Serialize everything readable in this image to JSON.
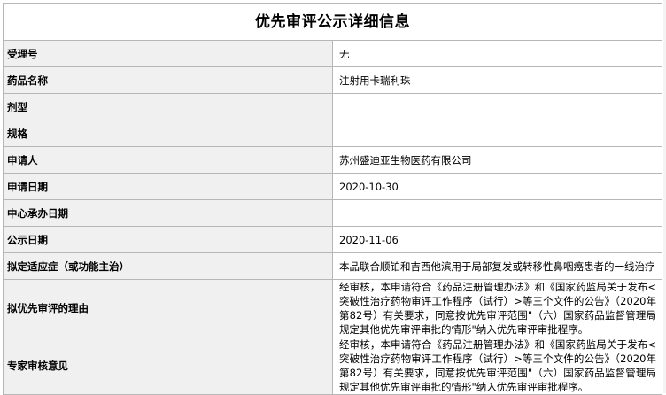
{
  "title": "优先审评公示详细信息",
  "rows": [
    {
      "label": "受理号",
      "value": "无"
    },
    {
      "label": "药品名称",
      "value": "注射用卡瑞利珠"
    },
    {
      "label": "剂型",
      "value": ""
    },
    {
      "label": "规格",
      "value": ""
    },
    {
      "label": "申请人",
      "value": "苏州盛迪亚生物医药有限公司"
    },
    {
      "label": "申请日期",
      "value": "2020-10-30"
    },
    {
      "label": "中心承办日期",
      "value": ""
    },
    {
      "label": "公示日期",
      "value": "2020-11-06"
    },
    {
      "label": "拟定适应症（或功能主治）",
      "value": "本品联合顺铂和吉西他滨用于局部复发或转移性鼻咽癌患者的一线治疗"
    },
    {
      "label": "拟优先审评的理由",
      "value": "经审核，本申请符合《药品注册管理办法》和《国家药监局关于发布<突破性治疗药物审评工作程序（试行）>等三个文件的公告》（2020年第82号）有关要求，同意按优先审评范围\"（六）国家药品监督管理局规定其他优先审评审批的情形\"纳入优先审评审批程序。"
    },
    {
      "label": "专家审核意见",
      "value": "经审核，本申请符合《药品注册管理办法》和《国家药监局关于发布<突破性治疗药物审评工作程序（试行）>等三个文件的公告》（2020年第82号）有关要求，同意按优先审评范围\"（六）国家药品监督管理局规定其他优先审评审批的情形\"纳入优先审评审批程序。"
    }
  ]
}
